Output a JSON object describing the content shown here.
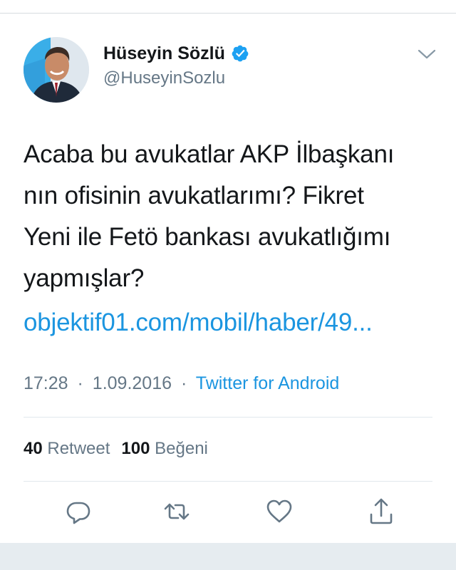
{
  "author": {
    "name": "Hüseyin Sözlü",
    "handle": "@HuseyinSozlu",
    "verified_icon": "verified-badge-icon",
    "avatar_icon": "avatar"
  },
  "tweet": {
    "text": "Acaba bu avukatlar AKP İlbaşkanı\nnın ofisinin avukatlarımı? Fikret\nYeni ile Fetö bankası avukatlığımı\nyapmışlar?",
    "link": "objektif01.com/mobil/haber/49..."
  },
  "meta": {
    "time": "17:28",
    "separator": "·",
    "date": "1.09.2016",
    "source": "Twitter for Android"
  },
  "stats": {
    "retweets_count": "40",
    "retweets_label": "Retweet",
    "likes_count": "100",
    "likes_label": "Beğeni"
  },
  "icons": {
    "menu": "chevron-down-icon",
    "reply": "reply-icon",
    "retweet": "retweet-icon",
    "like": "heart-icon",
    "share": "share-icon"
  },
  "colors": {
    "link": "#1b95e0",
    "secondary": "#657786",
    "primary_text": "#14171a",
    "verified": "#1da1f2"
  }
}
